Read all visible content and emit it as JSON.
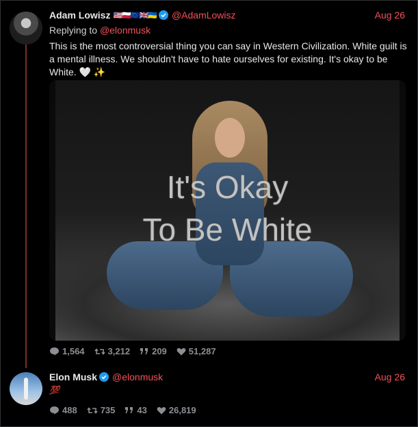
{
  "tweet1": {
    "name": "Adam Lowisz",
    "flags": "🇺🇸🇵🇱🇪🇺🇬🇧🇺🇦",
    "handle": "@AdamLowisz",
    "date": "Aug 26",
    "replying_prefix": "Replying to",
    "replying_handle": "@elonmusk",
    "text": "This is the most controversial thing you can say in Western Civilization. White guilt is a mental illness. We shouldn't have to hate ourselves for existing. It's okay to be White. 🤍 ✨",
    "image_text_line1": "It's Okay",
    "image_text_line2": "To Be White",
    "stats": {
      "replies": "1,564",
      "retweets": "3,212",
      "quotes": "209",
      "likes": "51,287"
    }
  },
  "tweet2": {
    "name": "Elon Musk",
    "handle": "@elonmusk",
    "date": "Aug 26",
    "text": "💯",
    "stats": {
      "replies": "488",
      "retweets": "735",
      "quotes": "43",
      "likes": "26,819"
    }
  },
  "colors": {
    "accent": "#f4515a",
    "verified": "#1d9bf0",
    "thread_line": "#7a2e2e",
    "muted": "#8b8f93"
  },
  "icons": [
    "comment-icon",
    "retweet-icon",
    "quote-icon",
    "heart-icon",
    "verified-icon"
  ]
}
